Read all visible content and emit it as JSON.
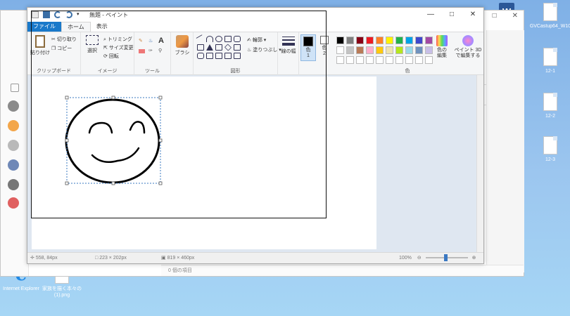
{
  "desktop": {
    "icons": [
      {
        "label": "GVCastup64_W10",
        "kind": "word"
      },
      {
        "label": "12-1",
        "kind": "doc"
      },
      {
        "label": "12-2",
        "kind": "doc"
      },
      {
        "label": "12-3",
        "kind": "doc"
      },
      {
        "label": "Internet Explorer",
        "kind": "ie"
      },
      {
        "label": "家族を描く本々の (1).png",
        "kind": "doc"
      }
    ]
  },
  "browser": {
    "status_text": "0 個の項目"
  },
  "paint": {
    "title": "無題 - ペイント",
    "tabs": {
      "file": "ファイル",
      "home": "ホーム",
      "view": "表示"
    },
    "ribbon": {
      "clipboard": {
        "paste": "貼り付け",
        "cut": "切り取り",
        "copy": "コピー",
        "label": "クリップボード"
      },
      "image": {
        "select": "選択",
        "crop": "トリミング",
        "resize": "サイズ変更",
        "rotate": "回転",
        "label": "イメージ"
      },
      "tools": {
        "label": "ツール",
        "text_glyph": "A"
      },
      "brush": {
        "label": "ブラシ"
      },
      "shapes": {
        "outline": "輪郭",
        "fill": "塗りつぶし",
        "label": "図形"
      },
      "size": {
        "label": "線の幅"
      },
      "color1": {
        "label": "色\n1"
      },
      "color2": {
        "label": "色\n2"
      },
      "edit_colors": {
        "label": "色の\n編集"
      },
      "paint3d": {
        "label": "ペイント 3D\nで編集する"
      },
      "colors_group_label": "色"
    },
    "palette_colors": [
      "#000000",
      "#7f7f7f",
      "#880015",
      "#ed1c24",
      "#ff7f27",
      "#fff200",
      "#22b14c",
      "#00a2e8",
      "#3f48cc",
      "#a349a4",
      "#ffffff",
      "#c3c3c3",
      "#b97a57",
      "#ffaec9",
      "#ffc90e",
      "#efe4b0",
      "#b5e61d",
      "#99d9ea",
      "#7092be",
      "#c8bfe7",
      "#ffffff",
      "#ffffff",
      "#ffffff",
      "#ffffff",
      "#ffffff",
      "#ffffff",
      "#ffffff",
      "#ffffff",
      "#ffffff",
      "#ffffff"
    ],
    "status": {
      "cursor": "558, 84px",
      "selection": "223 × 202px",
      "size": "819 × 460px",
      "zoom": "100%"
    }
  }
}
